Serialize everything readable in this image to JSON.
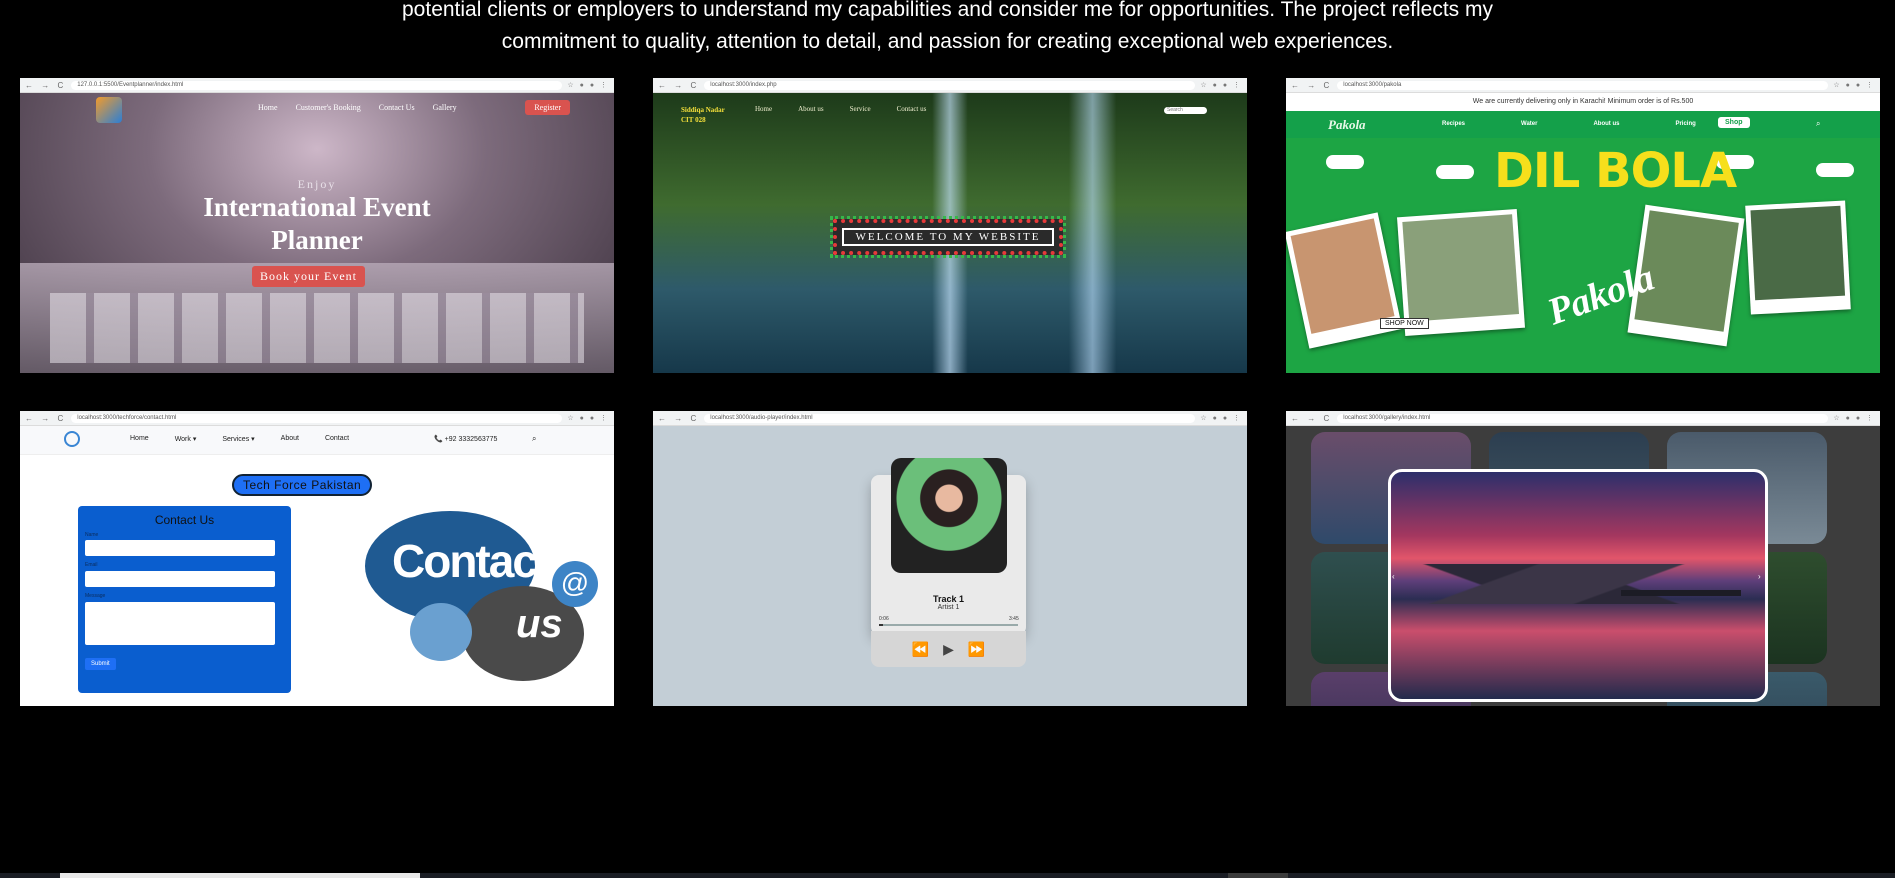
{
  "intro": {
    "line1": "potential clients or employers to understand my capabilities and consider me for opportunities. The project reflects my",
    "line2": "commitment to quality, attention to detail, and passion for creating exceptional web experiences."
  },
  "browser": {
    "nav": "← → C",
    "ext": "☆ ● ● ⋮"
  },
  "projects": [
    {
      "url": "127.0.0.1:5500/Eventplanner/index.html",
      "menu": [
        "Home",
        "Customer's Booking",
        "Contact Us",
        "Gallery"
      ],
      "register": "Register",
      "enjoy": "Enjoy",
      "hero_line1": "International Event",
      "hero_line2": "Planner",
      "cta": "Book your Event"
    },
    {
      "url": "localhost:3000/index.php",
      "brand_line1": "Siddiqa Nadar",
      "brand_line2": "CIT 028",
      "menu": [
        "Home",
        "About us",
        "Service",
        "Contact us"
      ],
      "search_placeholder": "Search",
      "welcome": "WELCOME TO MY WEBSITE"
    },
    {
      "url": "localhost:3000/pakola",
      "notice": "We are currently delivering only in Karachi! Minimum order is of Rs.500",
      "logo": "Pakola",
      "menu": [
        "Recipes",
        "Water",
        "About us",
        "Pricing"
      ],
      "shop": "Shop",
      "title": "DIL BOLA",
      "shop_now": "SHOP NOW"
    },
    {
      "url": "localhost:3000/techforce/contact.html",
      "menu": [
        "Home",
        "Work ▾",
        "Services ▾",
        "About",
        "Contact"
      ],
      "phone": "📞 +92 3332563775",
      "badge": "Tech Force Pakistan",
      "form_title": "Contact Us",
      "label_name": "Name",
      "label_email": "Email",
      "label_message": "Message",
      "submit": "Submit",
      "graphic_contact": "Contact",
      "graphic_us": "us",
      "graphic_at": "@"
    },
    {
      "url": "localhost:3000/audio-player/index.html",
      "track": "Track 1",
      "artist": "Artist 1",
      "time_current": "0:06",
      "time_total": "3:45",
      "prev": "⏪",
      "play": "▶",
      "next": "⏩",
      "progress": 0.03
    },
    {
      "url": "localhost:3000/gallery/index.html",
      "prev": "‹",
      "next": "›"
    }
  ]
}
